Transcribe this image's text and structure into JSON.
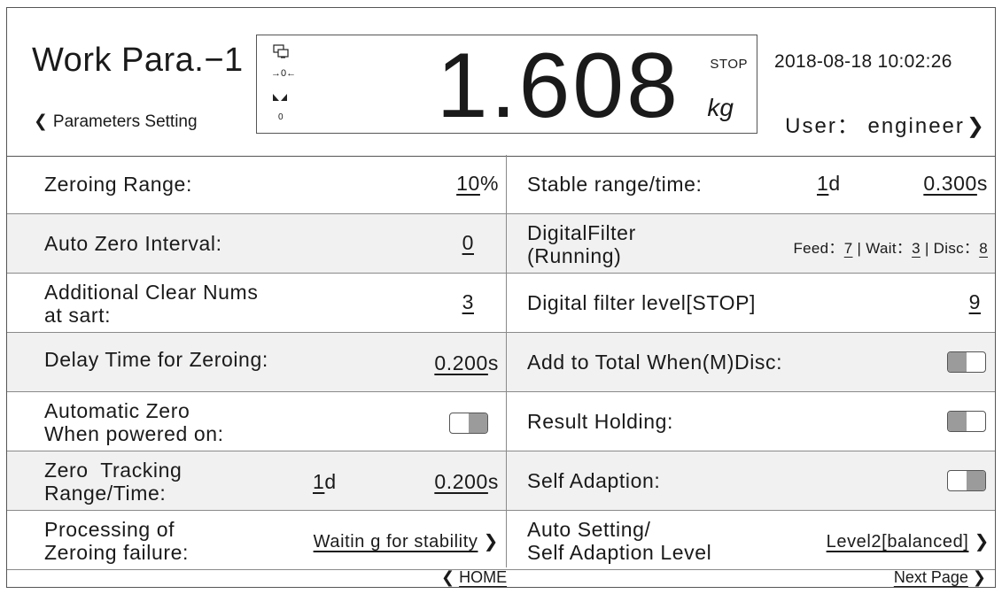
{
  "header": {
    "title": "Work Para.−1",
    "back_label": "Parameters Setting",
    "datetime": "2018-08-18 10:02:26",
    "user_label": "User： engineer"
  },
  "display": {
    "weight": "1.608",
    "status": "STOP",
    "unit": "kg",
    "zero_icon_text": "→0←",
    "count_text": "0"
  },
  "left": {
    "zeroing_range": {
      "label": "Zeroing Range:",
      "value": "10",
      "suffix": "%"
    },
    "auto_zero_interval": {
      "label": "Auto Zero Interval:",
      "value": "0"
    },
    "additional_clear": {
      "label_line1": "Additional Clear Nums",
      "label_line2": "at sart:",
      "value": "3"
    },
    "delay_time": {
      "label": "Delay Time for Zeroing:",
      "value": "0.200",
      "suffix": "s"
    },
    "auto_zero_power": {
      "label_line1": "Automatic Zero",
      "label_line2": "When powered on:",
      "state": "off"
    },
    "zero_tracking": {
      "label_line1": "Zero  Tracking",
      "label_line2": "Range/Time:",
      "range_value": "1",
      "range_suffix": "d",
      "time_value": "0.200",
      "time_suffix": "s"
    },
    "processing_failure": {
      "label_line1": "Processing of",
      "label_line2": "Zeroing failure:",
      "value": "Waitin g for stability"
    }
  },
  "right": {
    "stable_range": {
      "label": "Stable range/time:",
      "range_value": "1",
      "range_suffix": "d",
      "time_value": "0.300",
      "time_suffix": "s"
    },
    "digital_filter": {
      "label_line1": "DigitalFilter",
      "label_line2": "(Running)",
      "feed_label": "Feed：",
      "feed_value": "7",
      "wait_label": "| Wait：",
      "wait_value": "3",
      "disc_label": "| Disc：",
      "disc_value": "8"
    },
    "filter_level": {
      "label": "Digital filter level[STOP]",
      "value": "9"
    },
    "add_to_total": {
      "label": "Add to Total When(M)Disc:",
      "state": "on"
    },
    "result_holding": {
      "label": "Result Holding:",
      "state": "on"
    },
    "self_adaption": {
      "label": "Self Adaption:",
      "state": "off"
    },
    "auto_setting": {
      "label_line1": "Auto Setting/",
      "label_line2": "Self Adaption Level",
      "value": "Level2[balanced]"
    }
  },
  "footer": {
    "home_label": "HOME",
    "next_label": "Next Page"
  },
  "colors": {
    "border": "#555555",
    "shade": "#f1f1f1",
    "toggle_knob": "#9b9b9b"
  }
}
